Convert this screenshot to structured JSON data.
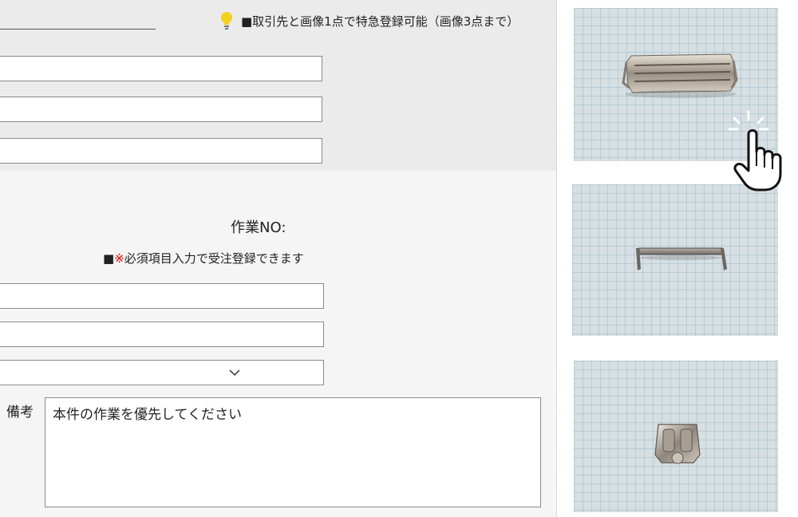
{
  "notice": {
    "text": "■取引先と画像1点で特急登録可能（画像3点まで）"
  },
  "order": {
    "work_no_label": "作業NO:",
    "required_prefix": "■",
    "required_mark": "※",
    "required_text": "必須項目入力で受注登録できます",
    "remarks_label": "備考",
    "remarks_value": "本件の作業を優先してください"
  },
  "photos": [
    {
      "name": "photo-1",
      "description_icon": "metal-bracket-long"
    },
    {
      "name": "photo-2",
      "description_icon": "metal-bracket-small"
    },
    {
      "name": "photo-3",
      "description_icon": "metal-clip"
    }
  ],
  "colors": {
    "required_mark": "#e00000",
    "bulb": "#f2d21b",
    "grid_paper": "#d7dfe2"
  },
  "icons": [
    "lightbulb-icon",
    "chevron-down-icon",
    "pointing-hand-icon"
  ]
}
